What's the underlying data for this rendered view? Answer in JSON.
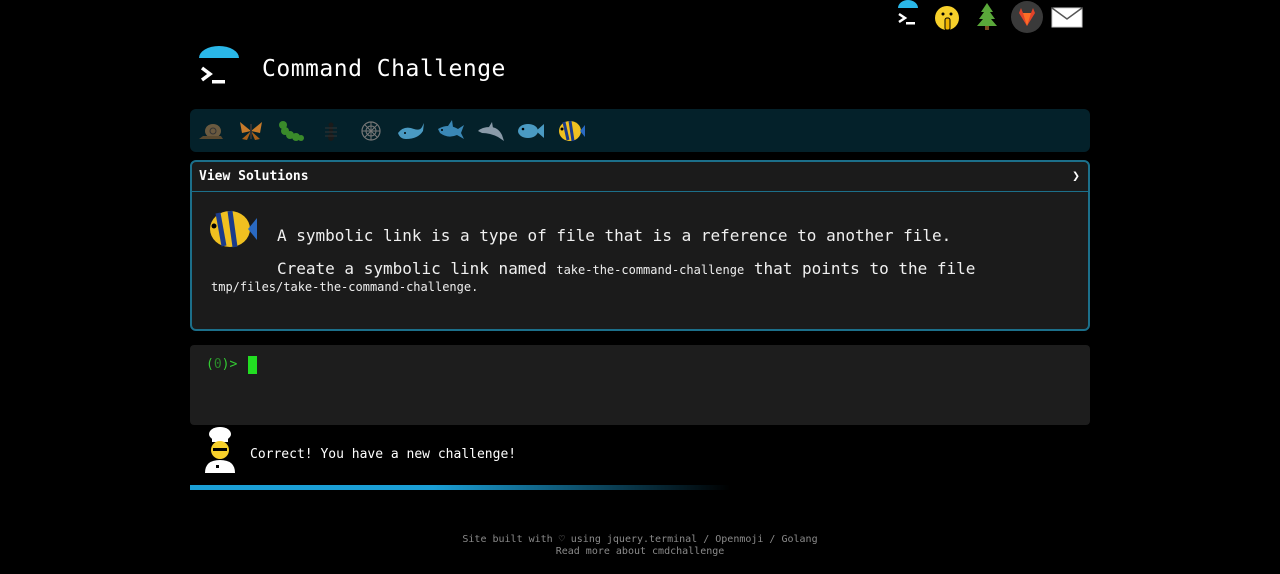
{
  "topbar": {
    "icons": [
      "terminal-icon",
      "shushing-face-icon",
      "tree-icon",
      "gitlab-icon",
      "mail-icon"
    ]
  },
  "header": {
    "title": "Command Challenge"
  },
  "levels": [
    "snail-icon",
    "butterfly-icon",
    "caterpillar-icon",
    "ant-icon",
    "spider-web-icon",
    "whale-icon",
    "shark-icon",
    "dolphin-icon",
    "fish-icon",
    "tropical-fish-icon"
  ],
  "card": {
    "head_label": "View Solutions",
    "chevron": "❯",
    "intro": "A symbolic link is a type of file that is a reference to another file.",
    "task_prefix": "Create a symbolic link named",
    "task_link": "take-the-command-challenge",
    "task_mid": "that points to the file",
    "task_path": "tmp/files/take-the-command-challenge",
    "task_end": "."
  },
  "terminal": {
    "prompt_open": "(",
    "prompt_num": "0",
    "prompt_close": ")>"
  },
  "status": {
    "message": "Correct! You have a new challenge!",
    "progress": 0.6
  },
  "footer": {
    "line1": "Site built with ♡ using jquery.terminal / Openmoji / Golang",
    "line2": "Read more about cmdchallenge"
  },
  "colors": {
    "accent": "#1b9fd6",
    "prompt": "#33cc33",
    "border": "#1c6f8a"
  }
}
